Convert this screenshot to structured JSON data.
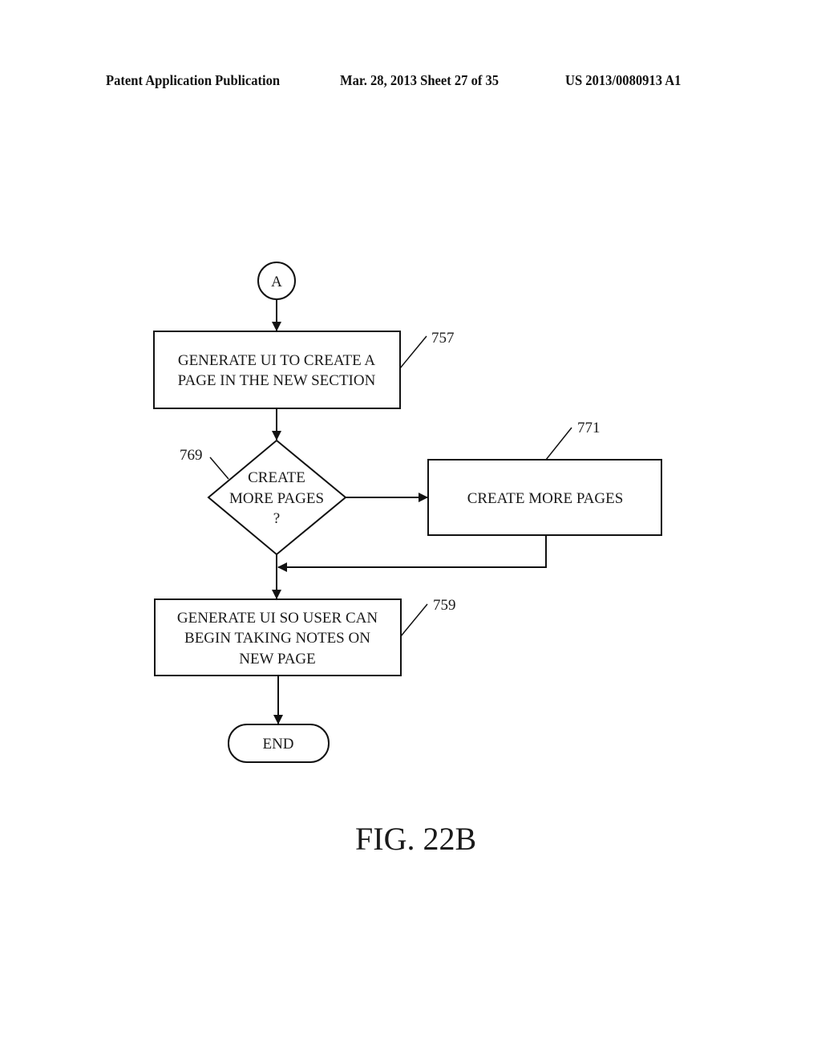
{
  "header": {
    "left": "Patent Application Publication",
    "middle": "Mar. 28, 2013  Sheet 27 of 35",
    "right": "US 2013/0080913 A1"
  },
  "diagram": {
    "connector": {
      "label": "A"
    },
    "nodes": [
      {
        "id": "757",
        "type": "process",
        "lines": [
          "GENERATE UI TO CREATE A",
          "PAGE IN THE NEW SECTION"
        ],
        "ref": "757"
      },
      {
        "id": "769",
        "type": "decision",
        "lines": [
          "CREATE",
          "MORE PAGES",
          "?"
        ],
        "ref": "769"
      },
      {
        "id": "771",
        "type": "process",
        "lines": [
          "CREATE MORE PAGES"
        ],
        "ref": "771"
      },
      {
        "id": "759",
        "type": "process",
        "lines": [
          "GENERATE UI SO USER CAN",
          "BEGIN TAKING NOTES ON",
          "NEW PAGE"
        ],
        "ref": "759"
      },
      {
        "id": "end",
        "type": "terminator",
        "lines": [
          "END"
        ]
      }
    ],
    "edges": [
      {
        "from": "A",
        "to": "757"
      },
      {
        "from": "757",
        "to": "769"
      },
      {
        "from": "769",
        "to": "771"
      },
      {
        "from": "771",
        "to": "759"
      },
      {
        "from": "769",
        "to": "759"
      },
      {
        "from": "759",
        "to": "end"
      }
    ]
  },
  "figure_label": "FIG. 22B"
}
